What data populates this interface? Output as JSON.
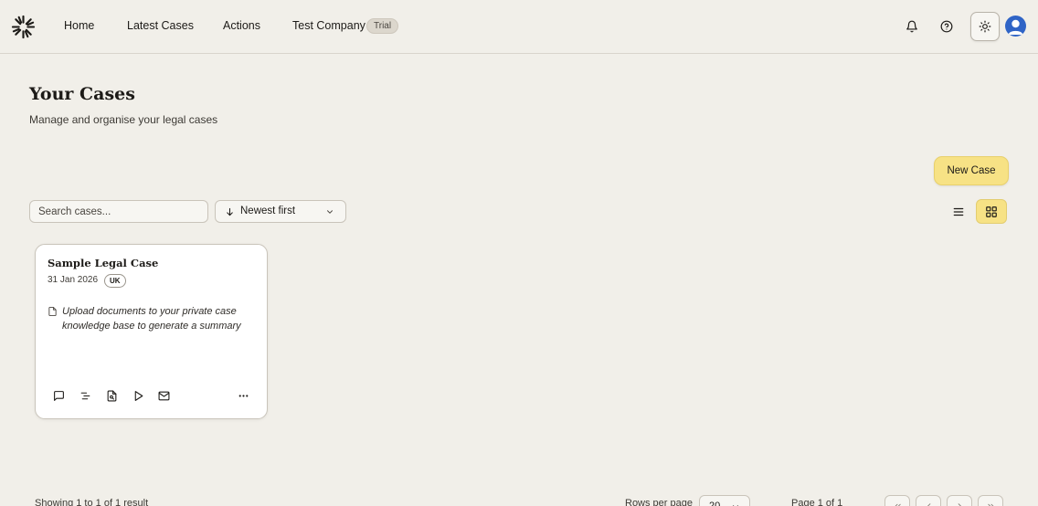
{
  "nav": {
    "items": [
      "Home",
      "Latest Cases",
      "Actions",
      "Test Company"
    ],
    "trial_badge": "Trial"
  },
  "page": {
    "title": "Your Cases",
    "subtitle": "Manage and organise your legal cases"
  },
  "toolbar": {
    "new_case_label": "New Case",
    "search_placeholder": "Search cases...",
    "sort_selected": "Newest first"
  },
  "cases": [
    {
      "title": "Sample Legal Case",
      "date": "31 Jan 2026",
      "region": "UK",
      "summary": "Upload documents to your private case knowledge base to generate a summary"
    }
  ],
  "footer": {
    "showing": "Showing 1 to 1 of 1 result",
    "rows_label": "Rows per page",
    "rows_value": "20",
    "page_label": "Page 1 of 1"
  },
  "colors": {
    "background": "#f1efe9",
    "accent": "#f7e285",
    "avatar": "#2f64c6"
  }
}
